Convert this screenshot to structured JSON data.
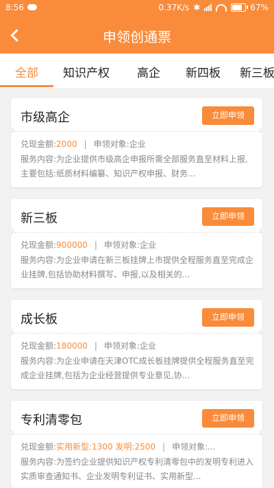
{
  "status_bar": {
    "time": "8:56",
    "speed": "0.37K/s",
    "battery": "67%",
    "battery_level": 0.67
  },
  "header": {
    "title": "申领创通票",
    "back_icon": "back-arrow-icon"
  },
  "tabs": [
    "全部",
    "知识产权",
    "高企",
    "新四板",
    "新三板"
  ],
  "active_tab": 0,
  "cards": [
    {
      "title": "市级高企",
      "button": "立即申领",
      "amount_label": "兑现金额:",
      "amount": "2000",
      "sep": "|",
      "target_label": "申领对象:",
      "target": "企业",
      "desc": "服务内容:为企业提供市级高企申报所需全部服务直至材料上报,主要包括:纸质材料编纂、知识产权申报、财务..."
    },
    {
      "title": "新三板",
      "button": "立即申领",
      "amount_label": "兑现金额:",
      "amount": "900000",
      "sep": "|",
      "target_label": "申领对象:",
      "target": "企业",
      "desc": "服务内容:为企业申请在新三板挂牌上市提供全程服务直至完成企业挂牌,包括协助材料撰写、申报,以及相关的..."
    },
    {
      "title": "成长板",
      "button": "立即申领",
      "amount_label": "兑现金额:",
      "amount": "180000",
      "sep": "|",
      "target_label": "申领对象:",
      "target": "企业",
      "desc": "服务内容:为企业申请在天津OTC成长板挂牌提供全程服务直至完成企业挂牌,包括为企业经营提供专业意见,协..."
    },
    {
      "title": "专利清零包",
      "button": "立即申领",
      "amount_label": "兑现金额:",
      "amount": "实用新型:1300 发明:2500",
      "sep": "|",
      "target_label": "申领对象:",
      "target": "...",
      "desc": "服务内容:为签约企业提供知识产权专利清零包中的发明专利进入实质审查通知书、企业发明专利证书、实用新型..."
    }
  ]
}
